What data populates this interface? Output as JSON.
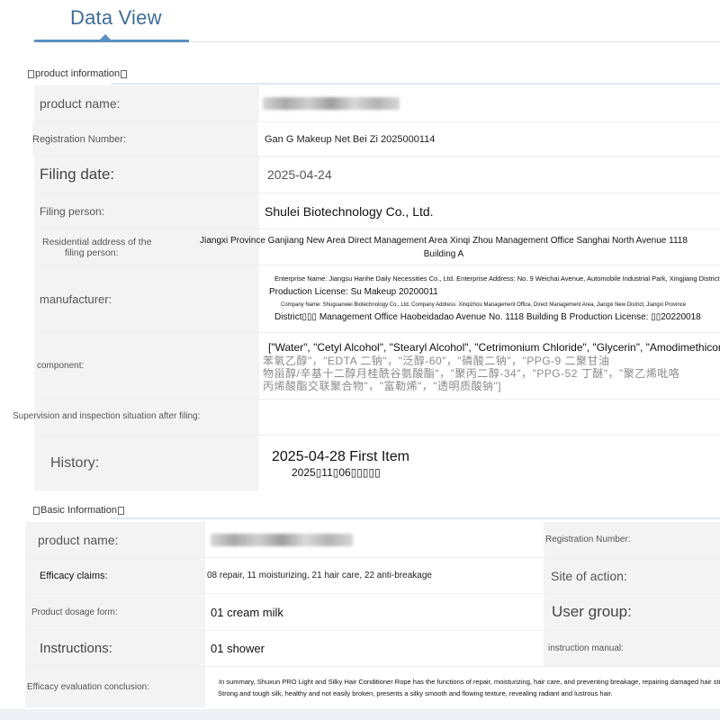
{
  "header": {
    "title": "Data View"
  },
  "product_info": {
    "section_label": "product information",
    "rows": {
      "product_name": {
        "label": "product name:"
      },
      "registration_number": {
        "label": "Registration Number:",
        "value": "Gan G Makeup Net Bei Zi 2025000114"
      },
      "filing_date": {
        "label": "Filing date:",
        "value": "2025-04-24"
      },
      "filing_person": {
        "label": "Filing person:",
        "value": "Shulei Biotechnology Co., Ltd."
      },
      "residential_address": {
        "label_line1": "Residential address of the",
        "label_line2": "filing person:",
        "value_line1": "Jiangxi Province Ganjiang New Area Direct Management Area Xinqi Zhou Management Office Sanghai North Avenue 1118",
        "value_line2": "Building A"
      },
      "manufacturer": {
        "label": "manufacturer:",
        "line1": "Enterprise Name: Jiangsu Hanhe Daily Necessities Co., Ltd. Enterprise Address: No. 9 Weichai Avenue, Automobile Industrial Park, Xingjiang District, Yangzhou",
        "line2": "Production License: Su Makeup 20200011",
        "line3": "Company Name: Shuguanwei Biotechnology Co., Ltd. Company Address: Xinqizhou Management Office, Direct Management Area, Jiangxi New District, Jiangxi Province",
        "line4": "District▯▯▯ Management Office Haobeidadao Avenue No. 1118 Building B Production License: ▯▯20220018"
      },
      "component": {
        "label": "component:",
        "line1": "[\"Water\", \"Cetyl Alcohol\", \"Stearyl Alcohol\", \"Cetrimonium Chloride\", \"Glycerin\", \"Amodimethicone\"]",
        "line2": "苯氧乙醇\"，\"EDTA 二钠\"，\"泛醇-60\"，\"磷酸二钠\"，\"PPG-9 二聚甘油",
        "line3": "物甾醇/辛基十二醇月桂酰谷氨酸酯\"，\"聚丙二醇-34\"，\"PPG-52 丁醚\"，\"聚乙烯吡咯",
        "line4": "丙烯酸酯交联聚合物\"，\"富勒烯\"，\"透明质酸钠\"]"
      },
      "supervision": {
        "label": "Supervision and inspection situation after filing:"
      },
      "history": {
        "label": "History:",
        "line1": "2025-04-28 First Item",
        "line2": "2025▯11▯06▯▯▯▯▯"
      }
    }
  },
  "basic_info": {
    "section_label": "Basic Information",
    "product_name_label": "product name:",
    "registration_number_label": "Registration Number:",
    "efficacy_claims_label": "Efficacy claims:",
    "efficacy_claims_value": "08 repair, 11 moisturizing, 21 hair care, 22 anti-breakage",
    "site_of_action_label": "Site of action:",
    "dosage_form_label": "Product dosage form:",
    "dosage_form_value": "01 cream milk",
    "user_group_label": "User group:",
    "instructions_label": "Instructions:",
    "instructions_value": "01 shower",
    "instruction_manual_label": "instruction manual:",
    "conclusion_label": "Efficacy evaluation conclusion:",
    "conclusion_line1": "In summary, Shuxun PRO Light and Silky Hair Conditioner Rope has the functions of repair, moisturizing, hair care, and preventing breakage, repairing damaged hair strands.",
    "conclusion_line2": "Strong and tough silk, healthy and not easily broken, presents a silky smooth and flowing texture, revealing radiant and lustrous hair."
  }
}
